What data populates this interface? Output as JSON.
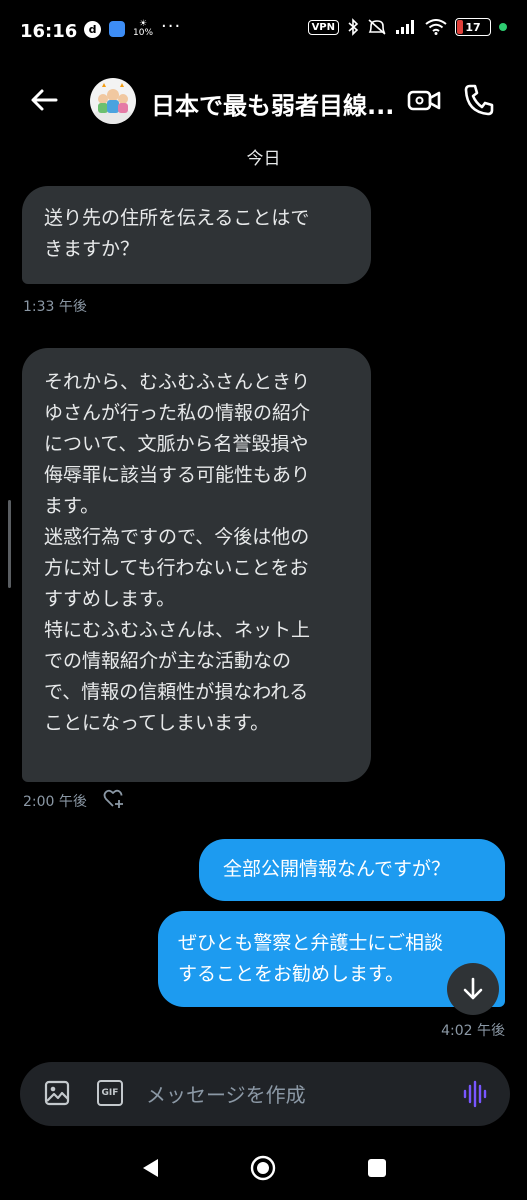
{
  "status_bar": {
    "time": "16:16",
    "app_badge": "d",
    "weather_percent": "10%",
    "more": "···",
    "vpn": "VPN",
    "battery": "17"
  },
  "header": {
    "title": "日本で最も弱者目線..."
  },
  "date_divider": "今日",
  "messages": [
    {
      "dir": "in",
      "text": "送り先の住所を伝えることはで\nきますか？",
      "time": "1:33 午後"
    },
    {
      "dir": "in",
      "text": "それから、むふむふさんときり\nゆさんが行った私の情報の紹介\nについて、文脈から名誉毀損や\n侮辱罪に該当する可能性もあり\nます。\n迷惑行為ですので、今後は他の\n方に対しても行わないことをお\nすすめします。\n特にむふむふさんは、ネット上\nでの情報紹介が主な活動なの\nで、情報の信頼性が損なわれる\nことになってしまいます。",
      "time": "2:00 午後"
    },
    {
      "dir": "out",
      "text": "全部公開情報なんですが？"
    },
    {
      "dir": "out",
      "text": "ぜひとも警察と弁護士にご相談\nすることをお勧めします。",
      "time": "4:02 午後"
    }
  ],
  "composer": {
    "placeholder": "メッセージを作成",
    "gif_label": "GIF"
  },
  "colors": {
    "background": "#000000",
    "incoming_bubble": "#2f3336",
    "outgoing_bubble": "#1d9bf0",
    "voice_accent": "#7856ff"
  },
  "icons": {
    "back": "arrow-left-icon",
    "video": "video-camera-icon",
    "call": "phone-icon",
    "image": "image-icon",
    "voice": "voice-waveform-icon",
    "react": "heart-plus-icon",
    "scroll_down": "arrow-down-icon"
  }
}
